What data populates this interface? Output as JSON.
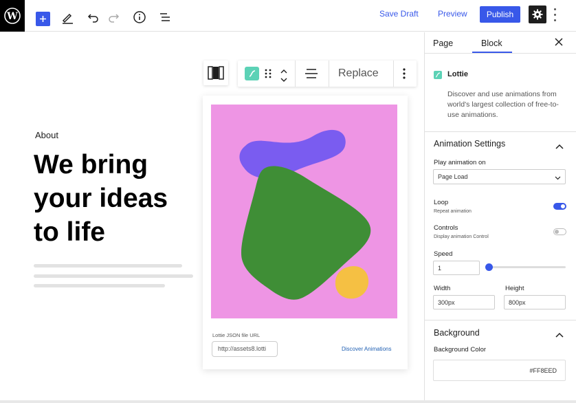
{
  "topbar": {
    "save_draft": "Save Draft",
    "preview": "Preview",
    "publish": "Publish",
    "icons": [
      "wordpress-logo-icon",
      "plus-icon",
      "pencil-icon",
      "undo-icon",
      "redo-icon",
      "info-icon",
      "list-view-icon",
      "gear-icon",
      "more-vertical-icon"
    ]
  },
  "canvas": {
    "about": "About",
    "headline": [
      "We bring",
      "your ideas",
      "to life"
    ]
  },
  "block_toolbar": {
    "replace": "Replace"
  },
  "lottie_card": {
    "url_label": "Lottie JSON file URL",
    "url_value": "http://assets8.lotti",
    "discover": "Discover Animations"
  },
  "sidebar": {
    "tabs": [
      "Page",
      "Block"
    ],
    "active_tab": "Block",
    "block_name": "Lottie",
    "block_desc": "Discover and use animations from world's largest collection of free-to-use animations.",
    "animation_settings": {
      "title": "Animation Settings",
      "play_on_label": "Play animation on",
      "play_on_value": "Page Load",
      "loop_label": "Loop",
      "loop_help": "Repeat animation",
      "loop_on": true,
      "controls_label": "Controls",
      "controls_help": "Display animation Control",
      "controls_on": false,
      "speed_label": "Speed",
      "speed_value": "1",
      "width_label": "Width",
      "width_value": "300px",
      "height_label": "Height",
      "height_value": "800px"
    },
    "background": {
      "title": "Background",
      "color_label": "Background Color",
      "color_value": "#FF8EED"
    }
  },
  "colors": {
    "accent": "#3858e9",
    "lottie_teal": "#5cd2b6",
    "art_background": "#ee95e4",
    "shape_purple": "#7a5cf0",
    "shape_green": "#3f8e36",
    "shape_yellow": "#f5c043"
  }
}
